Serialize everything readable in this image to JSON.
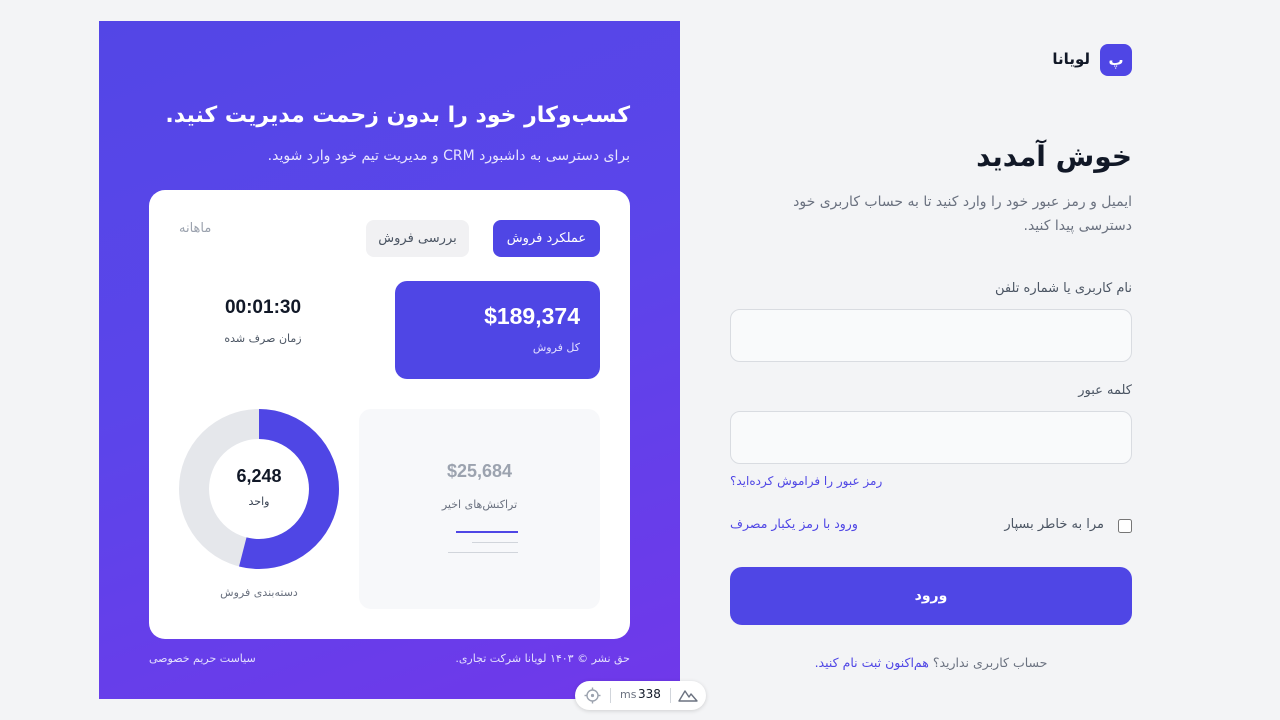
{
  "promo": {
    "title": "کسب‌وکار خود را بدون زحمت مدیریت کنید.",
    "subtitle": "برای دسترسی به داشبورد CRM و مدیریت تیم خود وارد شوید.",
    "card": {
      "tabs": [
        {
          "label": "عملکرد فروش",
          "active": true
        },
        {
          "label": "بررسی فروش",
          "active": false
        }
      ],
      "period": "ماهانه",
      "total_sales": {
        "value": "$189,374",
        "label": "کل فروش"
      },
      "time_spent": {
        "value": "00:01:30",
        "label": "زمان صرف شده"
      },
      "recent_transactions": {
        "value": "$25,684",
        "label": "تراکنش‌های اخیر"
      },
      "donut": {
        "value": "6,248",
        "unit": "واحد",
        "caption": "دسته‌بندی فروش",
        "fill_fraction": 0.54
      }
    },
    "copyright": "حق نشر © ۱۴۰۳ لویانا شرکت تجاری.",
    "privacy": "سیاست حریم خصوصی"
  },
  "brand": {
    "logo_letter": "پ",
    "name": "لویانا"
  },
  "login": {
    "title": "خوش آمدید",
    "subtitle": "ایمیل و رمز عبور خود را وارد کنید تا به حساب کاربری خود دسترسی پیدا کنید.",
    "username_label": "نام کاربری یا شماره تلفن",
    "username_value": "",
    "password_label": "کلمه عبور",
    "password_value": "",
    "forgot": "رمز عبور را فراموش کرده‌اید؟",
    "remember": "مرا به خاطر بسپار",
    "otp": "ورود با رمز یکبار مصرف",
    "submit": "ورود",
    "signup_prompt": "حساب کاربری ندارید؟",
    "signup_link": "هم‌اکنون ثبت نام کنید."
  },
  "devbar": {
    "ms_label": "ms",
    "value": "338"
  },
  "colors": {
    "accent": "#4f46e5",
    "background": "#f3f4f6",
    "donut_track": "#e5e7eb"
  },
  "icons": [
    "crosshair-icon",
    "mountain-icon"
  ]
}
